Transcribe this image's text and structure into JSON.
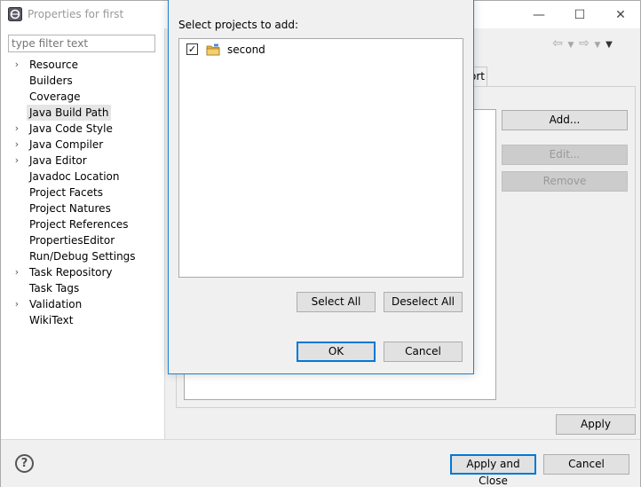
{
  "window": {
    "title": "Properties for first",
    "controls": {
      "minimize": "—",
      "maximize": "☐",
      "close": "✕"
    }
  },
  "sidebar": {
    "filter_placeholder": "type filter text",
    "items": [
      {
        "label": "Resource",
        "expandable": true,
        "selected": false
      },
      {
        "label": "Builders",
        "expandable": false,
        "selected": false
      },
      {
        "label": "Coverage",
        "expandable": false,
        "selected": false
      },
      {
        "label": "Java Build Path",
        "expandable": false,
        "selected": true
      },
      {
        "label": "Java Code Style",
        "expandable": true,
        "selected": false
      },
      {
        "label": "Java Compiler",
        "expandable": true,
        "selected": false
      },
      {
        "label": "Java Editor",
        "expandable": true,
        "selected": false
      },
      {
        "label": "Javadoc Location",
        "expandable": false,
        "selected": false
      },
      {
        "label": "Project Facets",
        "expandable": false,
        "selected": false
      },
      {
        "label": "Project Natures",
        "expandable": false,
        "selected": false
      },
      {
        "label": "Project References",
        "expandable": false,
        "selected": false
      },
      {
        "label": "PropertiesEditor",
        "expandable": false,
        "selected": false
      },
      {
        "label": "Run/Debug Settings",
        "expandable": false,
        "selected": false
      },
      {
        "label": "Task Repository",
        "expandable": true,
        "selected": false
      },
      {
        "label": "Task Tags",
        "expandable": false,
        "selected": false
      },
      {
        "label": "Validation",
        "expandable": true,
        "selected": false
      },
      {
        "label": "WikiText",
        "expandable": false,
        "selected": false
      }
    ]
  },
  "main": {
    "tab_fragment": "ort",
    "buttons": {
      "add": "Add...",
      "edit": "Edit...",
      "remove": "Remove",
      "apply": "Apply"
    }
  },
  "footer": {
    "help": "?",
    "apply_close": "Apply and Close",
    "cancel": "Cancel"
  },
  "dialog": {
    "label": "Select projects to add:",
    "projects": [
      {
        "name": "second",
        "checked": true
      }
    ],
    "select_all": "Select All",
    "deselect_all": "Deselect All",
    "ok": "OK",
    "cancel": "Cancel"
  },
  "colors": {
    "accent": "#0078d7",
    "selection": "#e5e5e5",
    "folder": "#e8b13c"
  }
}
